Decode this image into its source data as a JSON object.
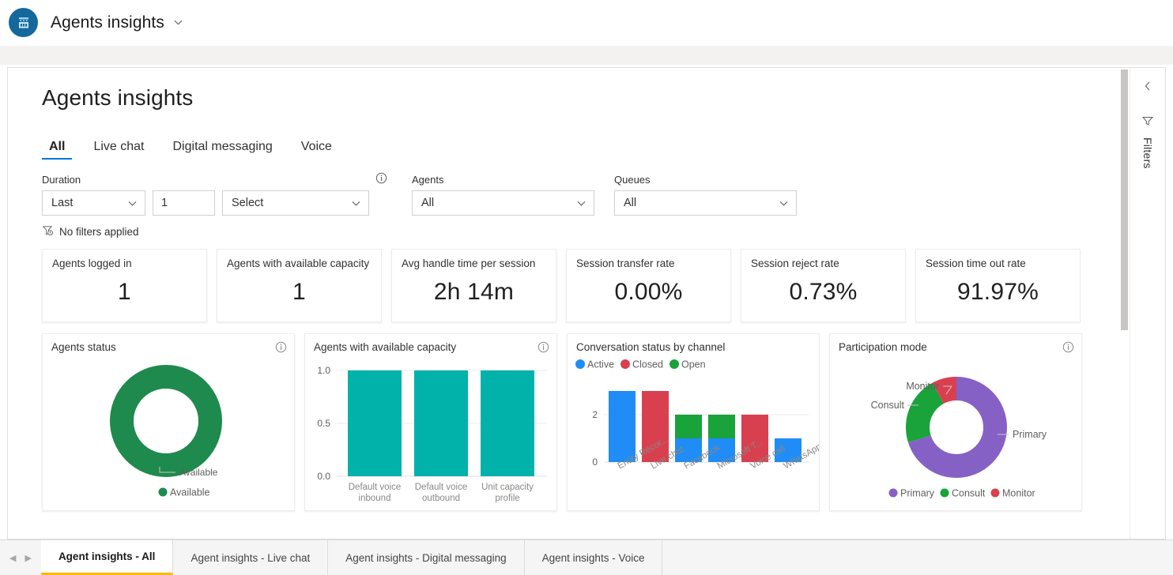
{
  "app": {
    "logo_icon": "dynamics-app-icon",
    "title": "Agents insights",
    "title_chevron_icon": "chevron-down-icon"
  },
  "page": {
    "title": "Agents insights"
  },
  "pivot": {
    "tabs": [
      {
        "label": "All",
        "active": true
      },
      {
        "label": "Live chat",
        "active": false
      },
      {
        "label": "Digital messaging",
        "active": false
      },
      {
        "label": "Voice",
        "active": false
      }
    ]
  },
  "filters": {
    "duration": {
      "label": "Duration",
      "info_icon": "info-icon",
      "mode_value": "Last",
      "count_value": "1",
      "unit_value": "Select",
      "chevron_icon": "chevron-down-icon"
    },
    "agents": {
      "label": "Agents",
      "value": "All",
      "chevron_icon": "chevron-down-icon"
    },
    "queues": {
      "label": "Queues",
      "value": "All",
      "chevron_icon": "chevron-down-icon"
    },
    "status": {
      "icon": "filter-off-icon",
      "text": "No filters applied"
    }
  },
  "kpis": [
    {
      "title": "Agents logged in",
      "value": "1"
    },
    {
      "title": "Agents with available capacity",
      "value": "1"
    },
    {
      "title": "Avg handle time per session",
      "value": "2h 14m"
    },
    {
      "title": "Session transfer rate",
      "value": "0.00%"
    },
    {
      "title": "Session reject rate",
      "value": "0.73%"
    },
    {
      "title": "Session time out rate",
      "value": "91.97%"
    }
  ],
  "charts": {
    "agents_status": {
      "title": "Agents status",
      "info_icon": "info-icon",
      "callout": "Available",
      "legend": [
        {
          "label": "Available",
          "color": "#1f8a4d"
        }
      ]
    },
    "available_capacity": {
      "title": "Agents with available capacity",
      "info_icon": "info-icon"
    },
    "conversation_status": {
      "title": "Conversation status by channel",
      "legend": [
        {
          "label": "Active",
          "color": "#1f8df5"
        },
        {
          "label": "Closed",
          "color": "#d9404f"
        },
        {
          "label": "Open",
          "color": "#19a33a"
        }
      ]
    },
    "participation_mode": {
      "title": "Participation mode",
      "info_icon": "info-icon",
      "callouts": {
        "monitor": "Monitor",
        "consult": "Consult",
        "primary": "Primary"
      },
      "legend": [
        {
          "label": "Primary",
          "color": "#8661c5"
        },
        {
          "label": "Consult",
          "color": "#19a33a"
        },
        {
          "label": "Monitor",
          "color": "#d9404f"
        }
      ]
    }
  },
  "chart_data": [
    {
      "type": "pie",
      "title": "Agents status",
      "labels": [
        "Available"
      ],
      "values": [
        1
      ],
      "colors": [
        "#1f8a4d"
      ],
      "donut": true,
      "legend_position": "bottom",
      "annotations": [
        "Available"
      ]
    },
    {
      "type": "bar",
      "title": "Agents with available capacity",
      "categories": [
        "Default voice inbound",
        "Default voice outbound",
        "Unit capacity profile"
      ],
      "values": [
        1.0,
        1.0,
        1.0
      ],
      "color": "#00b2a9",
      "ylim": [
        0.0,
        1.0
      ],
      "yticks": [
        "0.0",
        "0.5",
        "1.0"
      ],
      "xlabel": "",
      "ylabel": "",
      "grid": true
    },
    {
      "type": "bar",
      "stacked": true,
      "title": "Conversation status by channel",
      "categories": [
        "Entity Recor...",
        "Live chat",
        "Facebook",
        "Microsoft T...",
        "Voice call",
        "WhatsApp"
      ],
      "series": [
        {
          "name": "Active",
          "color": "#1f8df5",
          "values": [
            3,
            0,
            1,
            1,
            0,
            1
          ]
        },
        {
          "name": "Closed",
          "color": "#d9404f",
          "values": [
            0,
            3,
            0,
            0,
            2,
            0
          ]
        },
        {
          "name": "Open",
          "color": "#19a33a",
          "values": [
            0,
            0,
            1,
            1,
            0,
            0
          ]
        }
      ],
      "ylim": [
        0,
        3
      ],
      "yticks": [
        "0",
        "2"
      ],
      "legend_position": "top",
      "grid": true
    },
    {
      "type": "pie",
      "title": "Participation mode",
      "labels": [
        "Primary",
        "Consult",
        "Monitor"
      ],
      "values": [
        70,
        22,
        8
      ],
      "colors": [
        "#8661c5",
        "#19a33a",
        "#d9404f"
      ],
      "donut": true,
      "legend_position": "bottom",
      "annotations": [
        "Monitor",
        "Consult",
        "Primary"
      ]
    }
  ],
  "right_rail": {
    "collapse_icon": "chevron-left-icon",
    "funnel_icon": "filter-icon",
    "label": "Filters"
  },
  "tabstrip": {
    "prev_icon": "caret-left-icon",
    "next_icon": "caret-right-icon",
    "tabs": [
      {
        "label": "Agent insights - All",
        "active": true
      },
      {
        "label": "Agent insights - Live chat",
        "active": false
      },
      {
        "label": "Agent insights - Digital messaging",
        "active": false
      },
      {
        "label": "Agent insights - Voice",
        "active": false
      }
    ]
  }
}
